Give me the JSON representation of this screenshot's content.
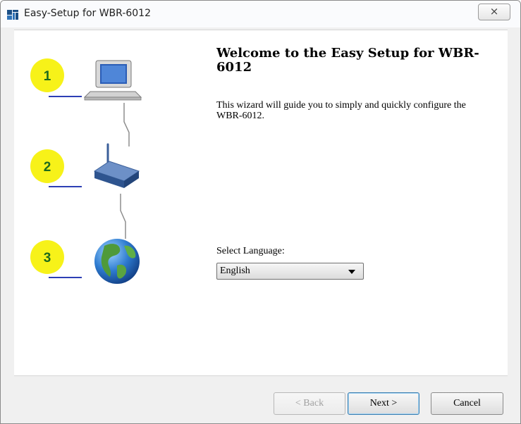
{
  "window": {
    "title": "Easy-Setup for WBR-6012",
    "close_label": "⨯"
  },
  "steps": [
    {
      "number": "1",
      "icon": "computer-icon"
    },
    {
      "number": "2",
      "icon": "router-icon"
    },
    {
      "number": "3",
      "icon": "globe-icon"
    }
  ],
  "main": {
    "title": "Welcome to the Easy Setup for WBR-6012",
    "description": "This wizard will guide you to simply and quickly configure the WBR-6012."
  },
  "language": {
    "label": "Select Language:",
    "selected": "English"
  },
  "buttons": {
    "back": "< Back",
    "next": "Next >",
    "cancel": "Cancel"
  },
  "colors": {
    "badge": "#f7f219",
    "step_number": "#1d6a1d",
    "underline": "#2d3fb5"
  }
}
